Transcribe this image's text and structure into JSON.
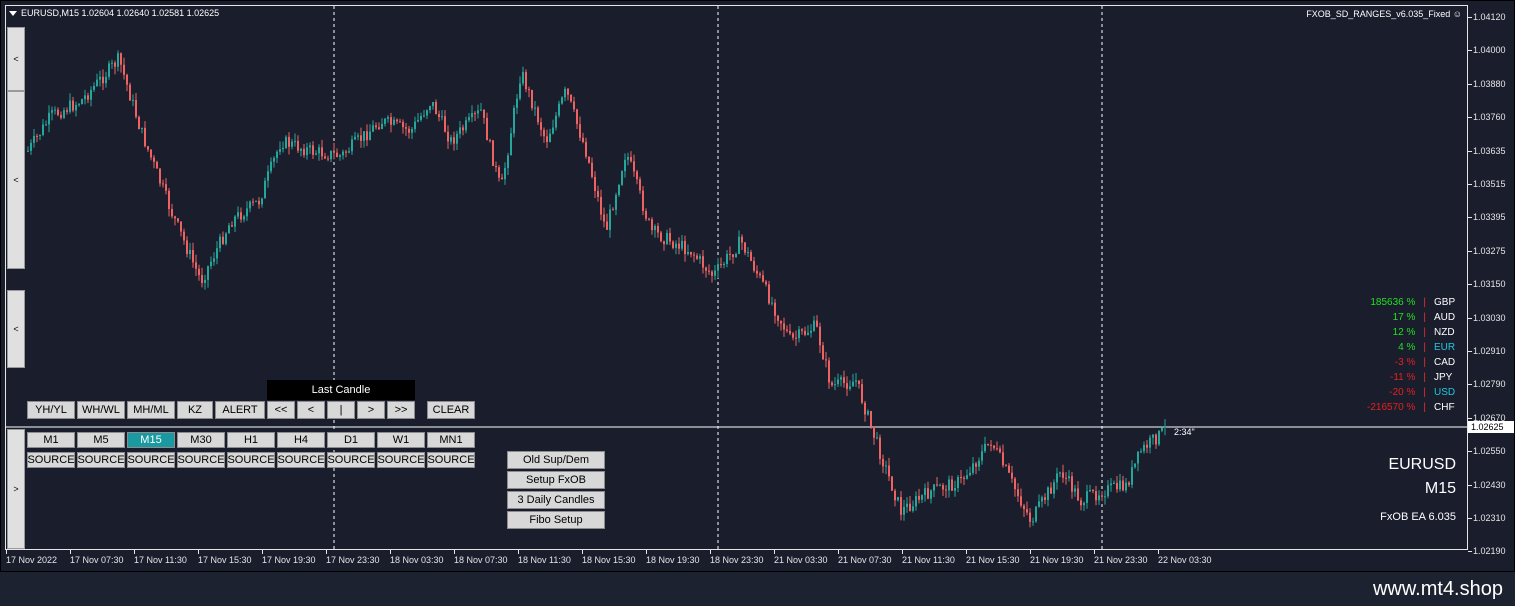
{
  "header": {
    "symbol_line": "EURUSD,M15  1.02604 1.02640 1.02581 1.02625",
    "indicator": "FXOB_SD_RANGES_v6.035_Fixed ☺"
  },
  "price_scale": [
    "1.04120",
    "1.04000",
    "1.03880",
    "1.03760",
    "1.03635",
    "1.03515",
    "1.03395",
    "1.03275",
    "1.03150",
    "1.03030",
    "1.02910",
    "1.02790",
    "1.02670",
    "1.02550",
    "1.02430",
    "1.02310",
    "1.02190"
  ],
  "current_price": "1.02625",
  "time_axis": [
    "17 Nov 2022",
    "17 Nov 07:30",
    "17 Nov 11:30",
    "17 Nov 15:30",
    "17 Nov 19:30",
    "17 Nov 23:30",
    "18 Nov 03:30",
    "18 Nov 07:30",
    "18 Nov 11:30",
    "18 Nov 15:30",
    "18 Nov 19:30",
    "18 Nov 23:30",
    "21 Nov 03:30",
    "21 Nov 07:30",
    "21 Nov 11:30",
    "21 Nov 15:30",
    "21 Nov 19:30",
    "21 Nov 23:30",
    "22 Nov 03:30"
  ],
  "side_tabs": [
    "<",
    "<",
    "<",
    ">"
  ],
  "toolbar_row1": [
    "YH/YL",
    "WH/WL",
    "MH/ML",
    "KZ",
    "ALERT"
  ],
  "nav_buttons": [
    "<<",
    "<",
    "|",
    ">",
    ">>"
  ],
  "last_candle": "Last Candle",
  "clear": "CLEAR",
  "timeframes": [
    "M1",
    "M5",
    "M15",
    "M30",
    "H1",
    "H4",
    "D1",
    "W1",
    "MN1"
  ],
  "active_timeframe": "M15",
  "source_label": "SOURCE",
  "panel_buttons": [
    "Old Sup/Dem",
    "Setup FxOB",
    "3 Daily Candles",
    "Fibo Setup"
  ],
  "strength": [
    {
      "value": "185636 %",
      "currency": "GBP",
      "color": "#22e022",
      "cur_color": "#ffffff"
    },
    {
      "value": "17 %",
      "currency": "AUD",
      "color": "#22e022",
      "cur_color": "#ffffff"
    },
    {
      "value": "12 %",
      "currency": "NZD",
      "color": "#22e022",
      "cur_color": "#ffffff"
    },
    {
      "value": "4 %",
      "currency": "EUR",
      "color": "#22e022",
      "cur_color": "#20c8e0"
    },
    {
      "value": "-3 %",
      "currency": "CAD",
      "color": "#e82020",
      "cur_color": "#ffffff"
    },
    {
      "value": "-11 %",
      "currency": "JPY",
      "color": "#e82020",
      "cur_color": "#ffffff"
    },
    {
      "value": "-20 %",
      "currency": "USD",
      "color": "#e82020",
      "cur_color": "#20c8e0"
    },
    {
      "value": "-216570 %",
      "currency": "CHF",
      "color": "#e82020",
      "cur_color": "#ffffff"
    }
  ],
  "info": {
    "symbol": "EURUSD",
    "timeframe": "M15",
    "ea": "FxOB EA 6.035",
    "countdown": "2:34\""
  },
  "footer": {
    "url": "www.mt4.shop"
  },
  "colors": {
    "bull": "#26a69a",
    "bear": "#ef6262",
    "background": "#191d2c",
    "accent": "#1a9aa0"
  }
}
